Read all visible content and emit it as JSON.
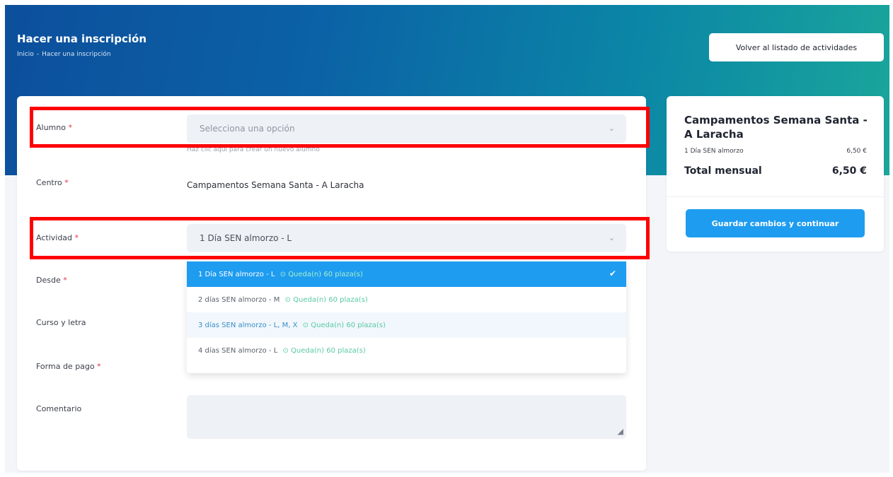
{
  "header": {
    "title": "Hacer una inscripción",
    "breadcrumb": [
      "Inicio",
      "-",
      "Hacer una inscripción"
    ],
    "back_button": "Volver al listado de actividades"
  },
  "form": {
    "alumno": {
      "label": "Alumno",
      "required": "*",
      "placeholder": "Selecciona una opción",
      "hint": "Haz clic aquí para crear un nuevo alumno"
    },
    "centro": {
      "label": "Centro",
      "required": "*",
      "value": "Campamentos Semana Santa - A Laracha"
    },
    "actividad": {
      "label": "Actividad",
      "required": "*",
      "value": "1 Día SEN almorzo - L"
    },
    "desde": {
      "label": "Desde",
      "required": "*"
    },
    "curso": {
      "label": "Curso y letra"
    },
    "forma_pago": {
      "label": "Forma de pago",
      "required": "*"
    },
    "comentario": {
      "label": "Comentario"
    },
    "options": [
      {
        "name": "1 Día SEN almorzo - L",
        "availability": "Queda(n) 60 plaza(s)",
        "state": "selected"
      },
      {
        "name": "2 días SEN almorzo - M",
        "availability": "Queda(n) 60 plaza(s)",
        "state": "normal"
      },
      {
        "name": "3 días SEN almorzo - L, M, X",
        "availability": "Queda(n) 60 plaza(s)",
        "state": "hover"
      },
      {
        "name": "4 días SEN almorzo - L",
        "availability": "Queda(n) 60 plaza(s)",
        "state": "normal"
      }
    ]
  },
  "summary": {
    "title": "Campamentos Semana Santa - A Laracha",
    "line_label": "1 Día SEN almorzo",
    "line_price": "6,50 €",
    "total_label": "Total mensual",
    "total_price": "6,50 €",
    "save_button": "Guardar cambios y continuar"
  },
  "colors": {
    "accent": "#1e9cf0",
    "highlight": "#ff0000",
    "required": "#e0324b",
    "availability": "#58c9a2"
  },
  "icons": {
    "dropdown": "chevron-down-icon",
    "selected": "check-icon",
    "resize": "resize-handle-icon"
  }
}
